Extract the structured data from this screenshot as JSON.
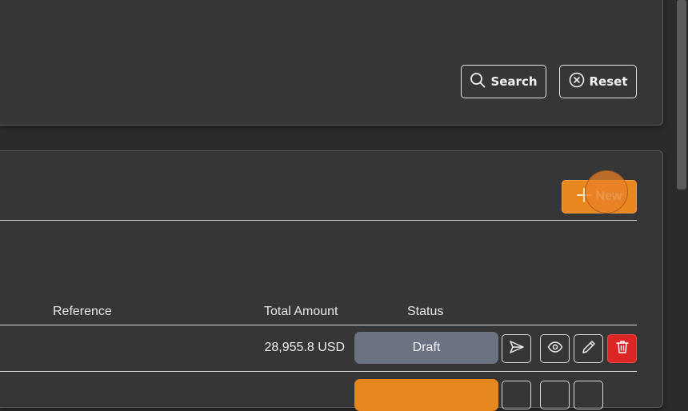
{
  "filter": {
    "search_label": "Search",
    "reset_label": "Reset"
  },
  "list": {
    "new_label": "New",
    "columns": {
      "reference": "Reference",
      "total_amount": "Total Amount",
      "status": "Status"
    },
    "rows": [
      {
        "reference": "",
        "total_amount": "28,955.8 USD",
        "status": "Draft",
        "status_color": "#6b7281"
      },
      {
        "reference": "",
        "total_amount": "",
        "status": "",
        "status_color": "#e8871d"
      }
    ]
  },
  "colors": {
    "accent": "#e8871d",
    "danger": "#dc2525",
    "panel": "#363636"
  },
  "icons": {
    "search": "search-icon",
    "reset": "close-circle-icon",
    "new": "plus-icon",
    "send": "send-icon",
    "view": "eye-icon",
    "edit": "pencil-icon",
    "delete": "trash-icon"
  }
}
